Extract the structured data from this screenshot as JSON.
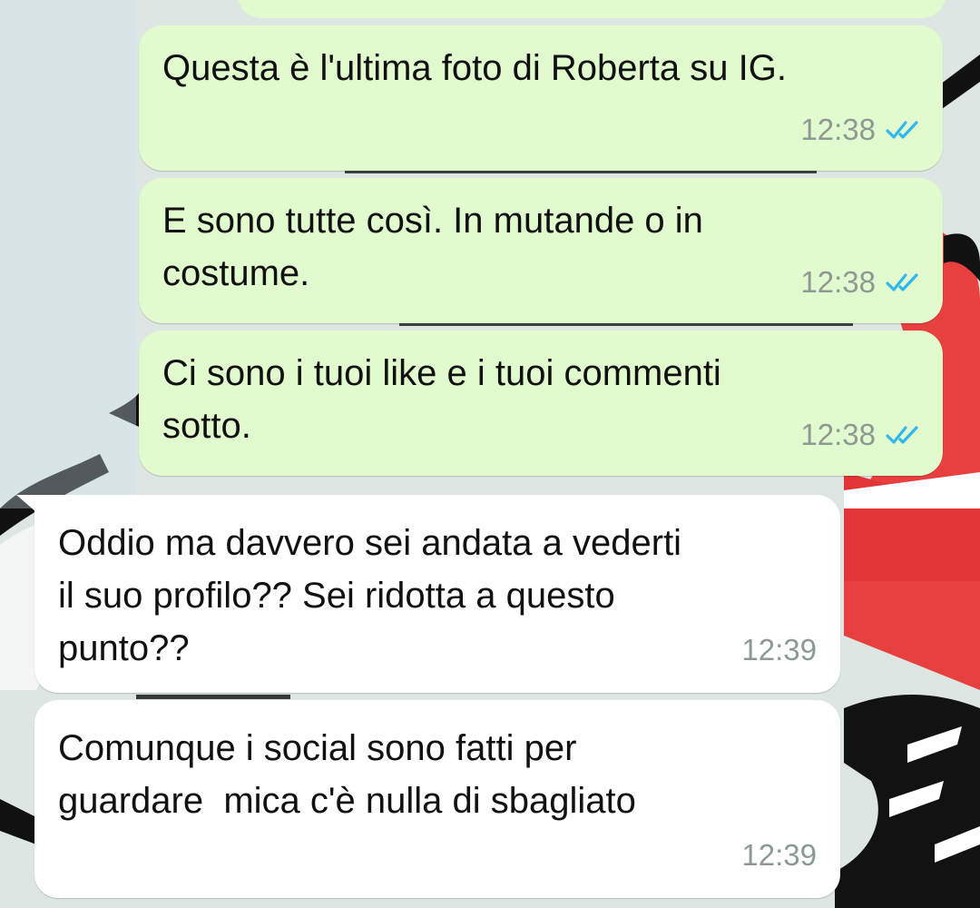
{
  "colors": {
    "outgoing_bubble": "#e1fbce",
    "incoming_bubble": "#ffffff",
    "timestamp": "#8c9a93",
    "read_ticks": "#34b7f1"
  },
  "messages": [
    {
      "direction": "outgoing",
      "text": "Questa è l'ultima foto di Roberta su IG.",
      "time": "12:38",
      "status": "read"
    },
    {
      "direction": "outgoing",
      "text": "E sono tutte così. In mutande o in\ncostume.",
      "time": "12:38",
      "status": "read"
    },
    {
      "direction": "outgoing",
      "text": "Ci sono i tuoi like e i tuoi commenti\nsotto.",
      "time": "12:38",
      "status": "read"
    },
    {
      "direction": "incoming",
      "text": "Oddio ma davvero sei andata a vederti\nil suo profilo?? Sei ridotta a questo\npunto??",
      "time": "12:39"
    },
    {
      "direction": "incoming",
      "text": "Comunque i social sono fatti per\nguardare  mica c'è nulla di sbagliato",
      "time": "12:39"
    }
  ]
}
